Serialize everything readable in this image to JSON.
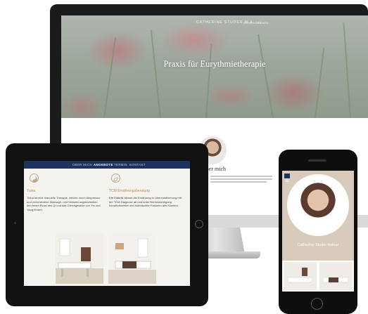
{
  "imac": {
    "brand": "CATHERINE STUDER M.A.",
    "nav": [
      "ANGEBOTE",
      "TERMIN"
    ],
    "hero_title": "Praxis für Eurythmietherapie",
    "content_heading": "Über mich"
  },
  "ipad": {
    "nav": [
      {
        "label": "ÜBER MICH",
        "active": false
      },
      {
        "label": "ANGEBOTE",
        "active": true
      },
      {
        "label": "TERMIN",
        "active": false
      },
      {
        "label": "KONTAKT",
        "active": false
      }
    ],
    "left_title": "Tuina",
    "left_body": "Tuina ist eine manuelle Therapie, welche durch Akupressur und verschiedene Massage- und Stimulierungstechniken den freien Fluss des Qi und das Gleichgewicht von Yin und Yang fördert.",
    "right_title": "TCM Ernährungsberatung",
    "right_body": "Die Diätetik stimmt die Ernährung in Übereinstimmung mit der TCM-Diagnose ab und unter Berücksichtigung konstitutioneller und individueller Faktoren des Klienten."
  },
  "iphone": {
    "name": "Catherine Studer Asfour"
  },
  "colors": {
    "navy": "#1e3260",
    "accent": "#b98b57",
    "sand": "#d8cbbb"
  }
}
